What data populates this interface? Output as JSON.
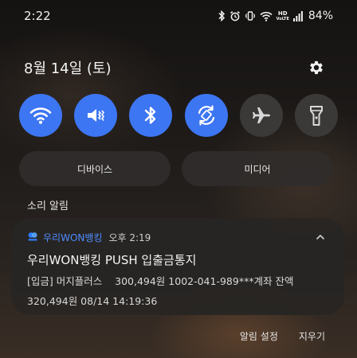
{
  "status_bar": {
    "time": "2:22",
    "network_badge_top": "HD",
    "network_badge_bottom": "VoLTE",
    "battery": "84%",
    "icons": [
      "bluetooth-icon",
      "alarm-icon",
      "vibrate-icon",
      "wifi-icon",
      "hd-badge",
      "signal-icon"
    ]
  },
  "header": {
    "date": "8월 14일 (토)",
    "settings_icon": "gear-icon"
  },
  "quick_settings": [
    {
      "name": "wifi",
      "icon": "wifi-icon",
      "active": true
    },
    {
      "name": "sound",
      "icon": "vibrate-icon",
      "active": true
    },
    {
      "name": "bluetooth",
      "icon": "bluetooth-icon",
      "active": true
    },
    {
      "name": "auto-rotate",
      "icon": "rotate-icon",
      "active": true
    },
    {
      "name": "airplane",
      "icon": "airplane-icon",
      "active": false
    },
    {
      "name": "flashlight",
      "icon": "flashlight-icon",
      "active": false
    }
  ],
  "pills": {
    "devices_label": "디바이스",
    "media_label": "미디어"
  },
  "section": {
    "label": "소리 알림"
  },
  "notification": {
    "app_name": "우리WON뱅킹",
    "time": "오후 2:19",
    "title": "우리WON뱅킹 PUSH 입출금통지",
    "line1": "[입금] 머지플러스    300,494원 1002-041-989***계좌 잔액",
    "line2": "320,494원 08/14 14:19:36"
  },
  "footer": {
    "settings_label": "알림 설정",
    "clear_label": "지우기"
  },
  "colors": {
    "accent": "#3d76f2",
    "app_name": "#4e8cff",
    "inactive_button": "#3b3938"
  }
}
